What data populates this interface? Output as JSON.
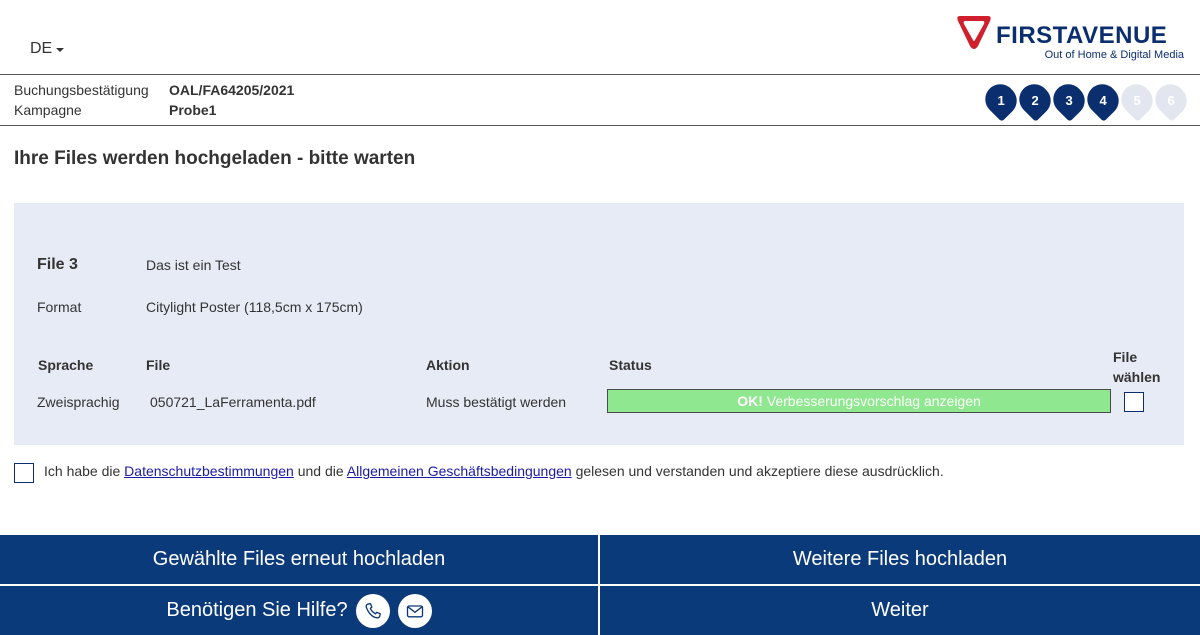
{
  "header": {
    "language": "DE",
    "logo": {
      "brand": "FIRSTAVENUE",
      "tagline": "Out of Home & Digital Media"
    }
  },
  "booking": {
    "confirmation_label": "Buchungsbestätigung",
    "confirmation_value": "OAL/FA64205/2021",
    "campaign_label": "Kampagne",
    "campaign_value": "Probe1"
  },
  "steps": [
    {
      "number": "1",
      "state": "active"
    },
    {
      "number": "2",
      "state": "active"
    },
    {
      "number": "3",
      "state": "active"
    },
    {
      "number": "4",
      "state": "active"
    },
    {
      "number": "5",
      "state": "inactive"
    },
    {
      "number": "6",
      "state": "inactive"
    }
  ],
  "page_title": "Ihre Files werden hochgeladen - bitte warten",
  "file_panel": {
    "file_label": "File 3",
    "file_value": "Das ist ein Test",
    "format_label": "Format",
    "format_value": "Citylight Poster (118,5cm x 175cm)",
    "columns": {
      "sprache": "Sprache",
      "file": "File",
      "aktion": "Aktion",
      "status": "Status",
      "waehlen_1": "File",
      "waehlen_2": "wählen"
    },
    "row": {
      "sprache": "Zweisprachig",
      "file": "050721_LaFerramenta.pdf",
      "aktion": "Muss bestätigt werden",
      "status_ok": "OK!",
      "status_text": " Verbesserungsvorschlag anzeigen",
      "selected": false
    }
  },
  "terms": {
    "prefix": "Ich habe die ",
    "link1": "Datenschutzbestimmungen",
    "middle": " und die ",
    "link2": "Allgemeinen Geschäftsbedingungen",
    "suffix": " gelesen und verstanden und akzeptiere diese ausdrücklich.",
    "checked": false
  },
  "buttons": {
    "reupload": "Gewählte Files erneut hochladen",
    "upload_more": "Weitere Files hochladen",
    "help": "Benötigen Sie Hilfe?",
    "next": "Weiter"
  },
  "colors": {
    "brand_blue": "#0b3a7a",
    "brand_red": "#d0202e",
    "panel_bg": "#e6ebf5",
    "status_green": "#8fe88f"
  }
}
